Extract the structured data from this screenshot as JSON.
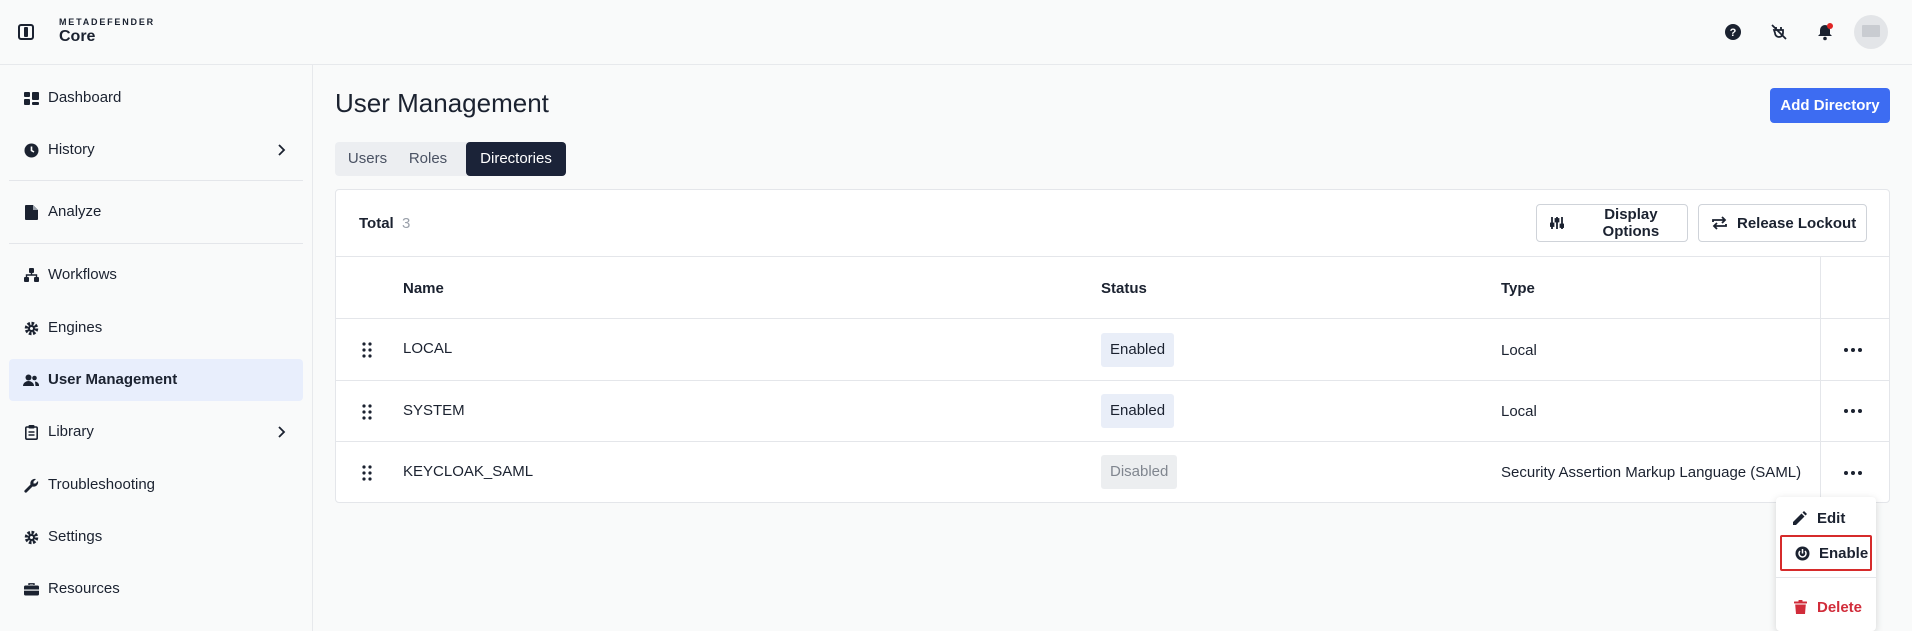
{
  "app": {
    "brand_top": "METADEFENDER",
    "brand_name": "Core"
  },
  "topbar": {
    "icons": [
      "help-icon",
      "plug-off-icon",
      "bell-icon",
      "avatar"
    ],
    "notification_color": "#e02424"
  },
  "sidebar": {
    "items": [
      {
        "label": "Dashboard",
        "icon": "dashboard-icon"
      },
      {
        "label": "History",
        "icon": "clock-icon",
        "has_chevron": true
      },
      {
        "label": "Analyze",
        "icon": "file-icon"
      },
      {
        "label": "Workflows",
        "icon": "workflow-icon"
      },
      {
        "label": "Engines",
        "icon": "gear-icon"
      },
      {
        "label": "User Management",
        "icon": "users-icon",
        "active": true
      },
      {
        "label": "Library",
        "icon": "clipboard-icon",
        "has_chevron": true
      },
      {
        "label": "Troubleshooting",
        "icon": "wrench-icon"
      },
      {
        "label": "Settings",
        "icon": "cog-icon"
      },
      {
        "label": "Resources",
        "icon": "toolbox-icon"
      }
    ]
  },
  "main": {
    "title": "User Management",
    "add_button": "Add Directory",
    "accent_color": "#3d6cf2",
    "tabs": [
      {
        "label": "Users"
      },
      {
        "label": "Roles"
      },
      {
        "label": "Directories",
        "active": true
      }
    ],
    "total_label": "Total",
    "total_count": "3",
    "display_options": "Display Options",
    "release_lockout": "Release Lockout",
    "columns": [
      "Name",
      "Status",
      "Type"
    ],
    "rows": [
      {
        "name": "LOCAL",
        "status": "Enabled",
        "type": "Local"
      },
      {
        "name": "SYSTEM",
        "status": "Enabled",
        "type": "Local"
      },
      {
        "name": "KEYCLOAK_SAML",
        "status": "Disabled",
        "type": "Security Assertion Markup Language (SAML)"
      }
    ]
  },
  "context_menu": {
    "edit": "Edit",
    "enable": "Enable",
    "delete": "Delete",
    "danger_color": "#d12c3a"
  }
}
